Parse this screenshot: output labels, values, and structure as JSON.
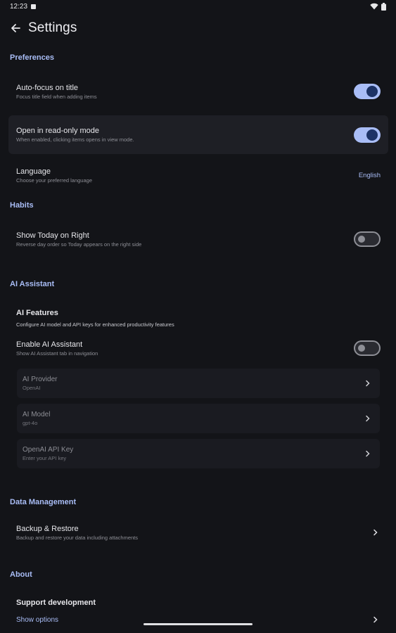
{
  "status_bar": {
    "time": "12:23"
  },
  "app_bar": {
    "title": "Settings"
  },
  "sections": {
    "preferences": "Preferences",
    "habits": "Habits",
    "ai_assistant": "AI Assistant",
    "data_management": "Data Management",
    "about": "About"
  },
  "preferences": {
    "autofocus": {
      "title": "Auto-focus on title",
      "subtitle": "Focus title field when adding items",
      "enabled": true
    },
    "readonly": {
      "title": "Open in read-only mode",
      "subtitle": "When enabled, clicking items opens in view mode.",
      "enabled": true
    },
    "language": {
      "title": "Language",
      "subtitle": "Choose your preferred language",
      "value": "English"
    }
  },
  "habits": {
    "today_right": {
      "title": "Show Today on Right",
      "subtitle": "Reverse day order so Today appears on the right side",
      "enabled": false
    }
  },
  "ai": {
    "features_title": "AI Features",
    "features_desc": "Configure AI model and API keys for enhanced productivity features",
    "enable": {
      "title": "Enable AI Assistant",
      "subtitle": "Show AI Assistant tab in navigation",
      "enabled": false
    },
    "provider": {
      "title": "AI Provider",
      "value": "OpenAI"
    },
    "model": {
      "title": "AI Model",
      "value": "gpt-4o"
    },
    "api_key": {
      "title": "OpenAI API Key",
      "value": "Enter your API key"
    }
  },
  "data": {
    "backup": {
      "title": "Backup & Restore",
      "subtitle": "Backup and restore your data including attachments"
    }
  },
  "about": {
    "support_title": "Support development",
    "show_options": "Show options"
  },
  "colors": {
    "accent": "#a9bdf6",
    "background": "#131418",
    "highlight": "#1e1f25"
  },
  "icons": {
    "back": "arrow-left-icon",
    "chevron": "chevron-right-icon"
  }
}
